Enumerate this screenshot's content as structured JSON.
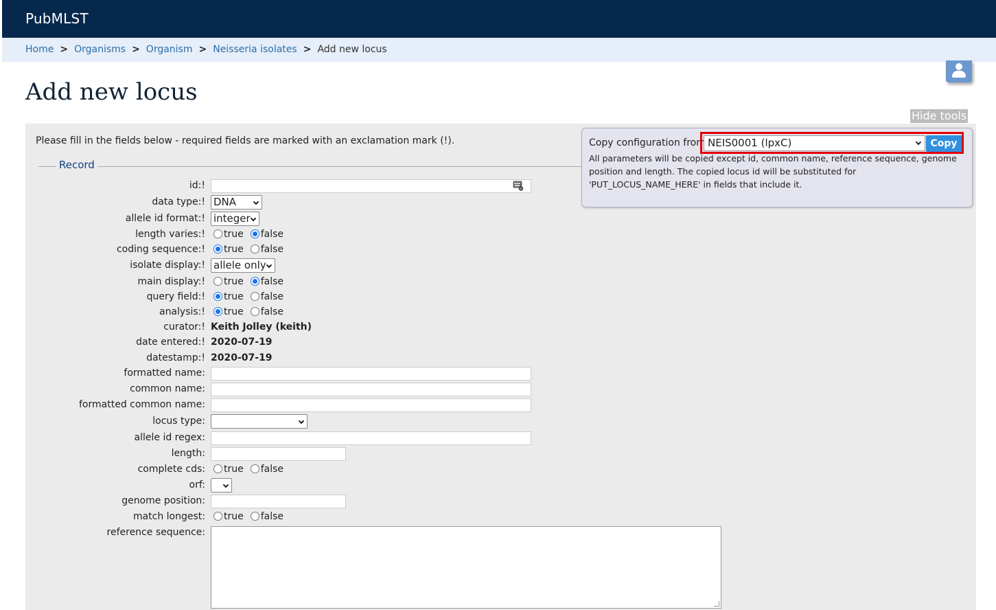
{
  "header": {
    "brand": "PubMLST"
  },
  "breadcrumb": {
    "items": [
      {
        "label": "Home"
      },
      {
        "label": "Organisms"
      },
      {
        "label": "Organism"
      },
      {
        "label": "Neisseria isolates"
      }
    ],
    "current": "Add new locus",
    "separator": ">"
  },
  "page": {
    "title": "Add new locus",
    "hide_tools": "Hide tools",
    "intro": "Please fill in the fields below - required fields are marked with an exclamation mark (!).",
    "legend": "Record"
  },
  "copy_tool": {
    "label": "Copy configuration from",
    "selected": "NEIS0001 (lpxC)",
    "button": "Copy",
    "description": "All parameters will be copied except id, common name, reference sequence, genome position and length. The copied locus id will be substituted for 'PUT_LOCUS_NAME_HERE' in fields that include it."
  },
  "options": {
    "true": "true",
    "false": "false"
  },
  "fields": {
    "id": {
      "label": "id:!",
      "value": ""
    },
    "data_type": {
      "label": "data type:!",
      "selected": "DNA"
    },
    "allele_id_format": {
      "label": "allele id format:!",
      "selected": "integer"
    },
    "length_varies": {
      "label": "length varies:!",
      "value": "false"
    },
    "coding_sequence": {
      "label": "coding sequence:!",
      "value": "true"
    },
    "isolate_display": {
      "label": "isolate display:!",
      "selected": "allele only"
    },
    "main_display": {
      "label": "main display:!",
      "value": "false"
    },
    "query_field": {
      "label": "query field:!",
      "value": "true"
    },
    "analysis": {
      "label": "analysis:!",
      "value": "true"
    },
    "curator": {
      "label": "curator:!",
      "value": "Keith Jolley (keith)"
    },
    "date_entered": {
      "label": "date entered:!",
      "value": "2020-07-19"
    },
    "datestamp": {
      "label": "datestamp:!",
      "value": "2020-07-19"
    },
    "formatted_name": {
      "label": "formatted name:",
      "value": ""
    },
    "common_name": {
      "label": "common name:",
      "value": ""
    },
    "formatted_common_name": {
      "label": "formatted common name:",
      "value": ""
    },
    "locus_type": {
      "label": "locus type:",
      "selected": ""
    },
    "allele_id_regex": {
      "label": "allele id regex:",
      "value": ""
    },
    "length": {
      "label": "length:",
      "value": ""
    },
    "complete_cds": {
      "label": "complete cds:",
      "value": ""
    },
    "orf": {
      "label": "orf:",
      "selected": ""
    },
    "genome_position": {
      "label": "genome position:",
      "value": ""
    },
    "match_longest": {
      "label": "match longest:",
      "value": ""
    },
    "reference_sequence": {
      "label": "reference sequence:",
      "value": ""
    }
  },
  "icons": {
    "user": "user-icon",
    "keyboard": "keyboard-icon"
  },
  "colors": {
    "header_bg": "#07284d",
    "breadcrumb_bg": "#e6eef9",
    "link": "#2a6ea8",
    "copy_button": "#3090e0",
    "highlight": "#e00000"
  }
}
